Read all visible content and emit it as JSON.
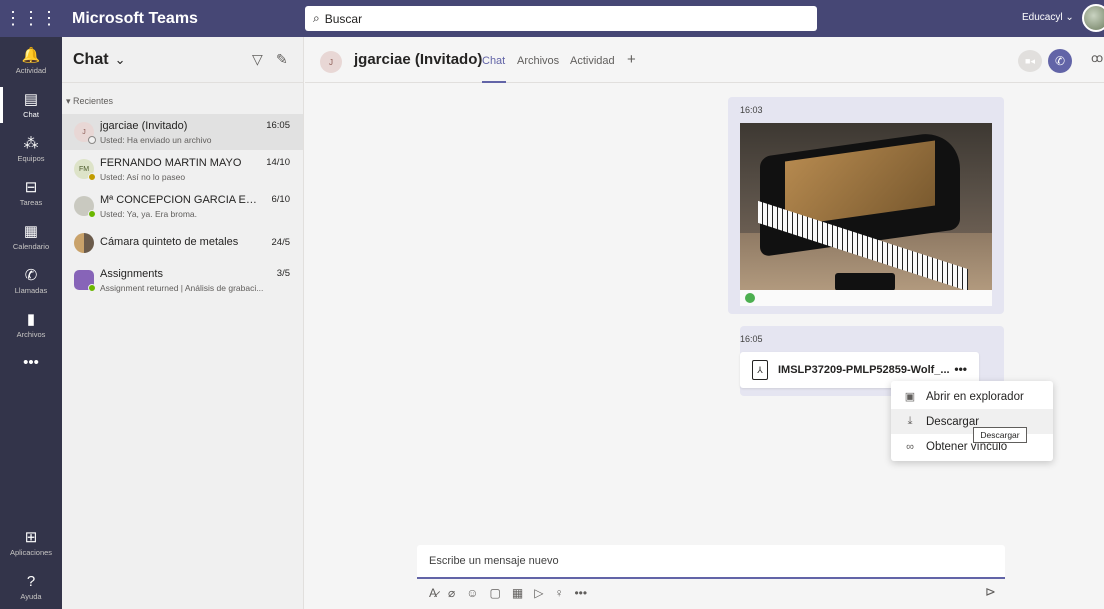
{
  "topbar": {
    "waffle_icon": "⋮⋮⋮",
    "app_title": "Microsoft Teams",
    "search_placeholder": "Buscar",
    "org_label": "Educacyl ⌄",
    "bg_color": "#464775"
  },
  "rail": {
    "items": [
      {
        "label": "Actividad",
        "icon": "bell-icon",
        "glyph": "🔔"
      },
      {
        "label": "Chat",
        "icon": "chat-icon",
        "glyph": "▤"
      },
      {
        "label": "Equipos",
        "icon": "teams-icon",
        "glyph": "⁂"
      },
      {
        "label": "Tareas",
        "icon": "assignments-icon",
        "glyph": "⊟"
      },
      {
        "label": "Calendario",
        "icon": "calendar-icon",
        "glyph": "▦"
      },
      {
        "label": "Llamadas",
        "icon": "phone-icon",
        "glyph": "✆"
      },
      {
        "label": "Archivos",
        "icon": "files-icon",
        "glyph": "▮"
      },
      {
        "label": "",
        "icon": "more-icon",
        "glyph": "•••"
      }
    ],
    "bottom": [
      {
        "label": "Aplicaciones",
        "icon": "apps-icon",
        "glyph": "⊞"
      },
      {
        "label": "Ayuda",
        "icon": "help-icon",
        "glyph": "?"
      }
    ]
  },
  "chatlist": {
    "title": "Chat",
    "section": "Recientes",
    "chats": [
      {
        "initials": "J",
        "name": "jgarciae (Invitado)",
        "time": "16:05",
        "preview": "Usted: Ha enviado un archivo"
      },
      {
        "initials": "FM",
        "name": "FERNANDO MARTIN MAYO",
        "time": "14/10",
        "preview": "Usted: Así no lo paseo"
      },
      {
        "initials": "",
        "name": "Mª CONCEPCION GARCIA ECHE...",
        "time": "6/10",
        "preview": "Usted: Ya, ya. Era broma."
      },
      {
        "initials": "",
        "name": "Cámara quinteto de metales",
        "time": "24/5",
        "preview": ""
      },
      {
        "initials": "",
        "name": "Assignments",
        "time": "3/5",
        "preview": "Assignment returned | Análisis de grabaci..."
      }
    ]
  },
  "conversation": {
    "avatar_initial": "J",
    "name": "jgarciae (Invitado)",
    "tabs": [
      "Chat",
      "Archivos",
      "Actividad",
      "+"
    ],
    "messages": [
      {
        "time": "16:03"
      },
      {
        "time": "16:05",
        "file_name": "IMSLP37209-PMLP52859-Wolf_..."
      }
    ],
    "more_glyph": "•••"
  },
  "context_menu": {
    "items": [
      {
        "label": "Abrir en explorador",
        "icon": "open-file-icon"
      },
      {
        "label": "Descargar",
        "icon": "download-icon"
      },
      {
        "label": "Obtener vínculo",
        "icon": "link-icon"
      }
    ],
    "tooltip": "Descargar"
  },
  "compose": {
    "placeholder": "Escribe un mensaje nuevo"
  },
  "colors": {
    "accent": "#6264a7",
    "rail_bg": "#33344a",
    "message_bg": "#e5e5f1"
  }
}
